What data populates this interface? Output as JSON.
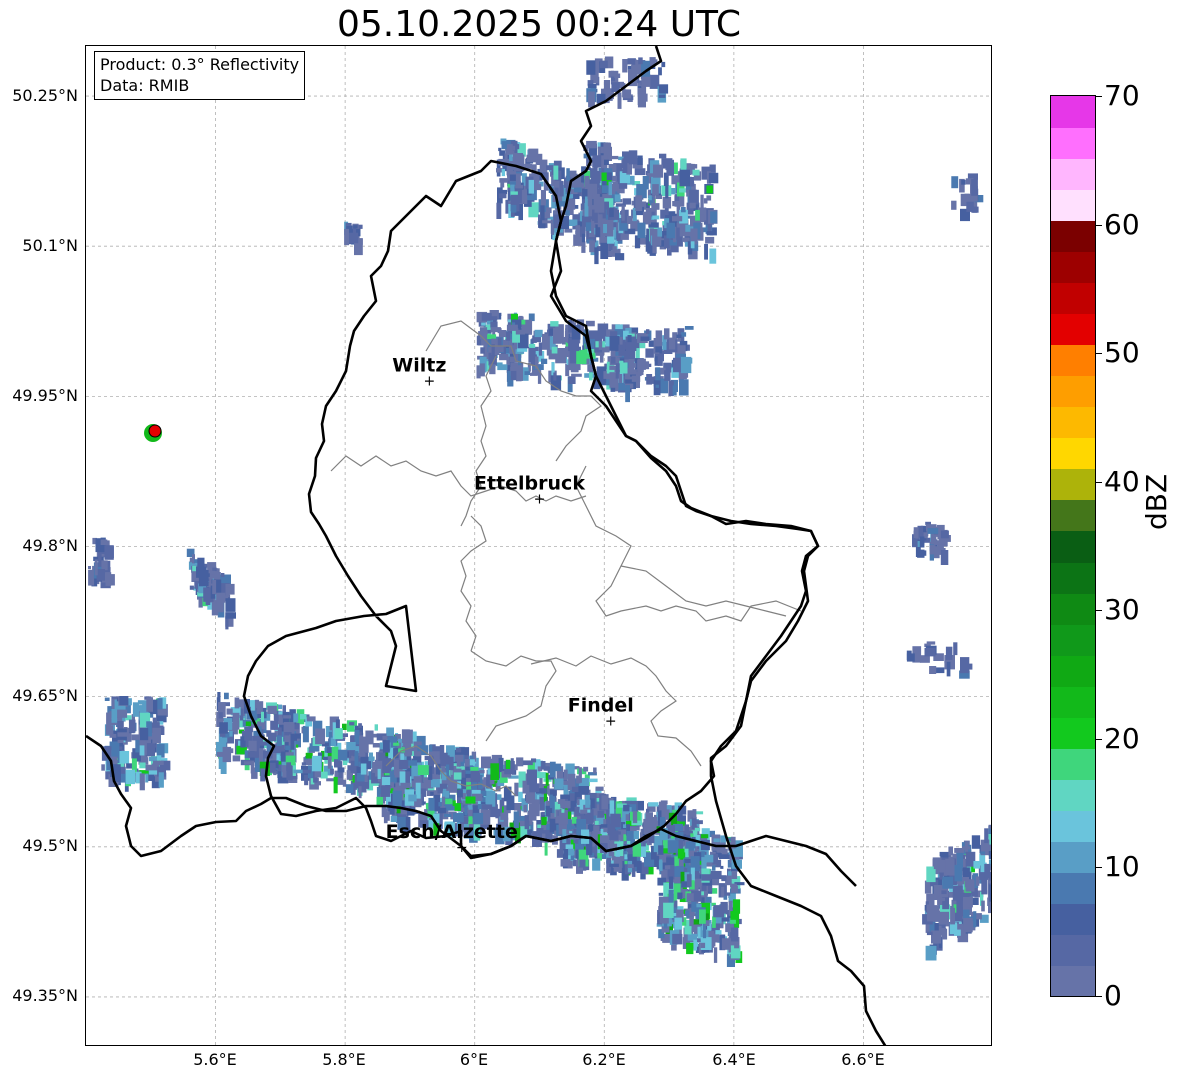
{
  "title": "05.10.2025 00:24 UTC",
  "info": {
    "product": "Product: 0.3° Reflectivity",
    "source": "Data: RMIB"
  },
  "map": {
    "lon_range": [
      5.4,
      6.8
    ],
    "lat_range": [
      49.3,
      50.3
    ],
    "grid": true,
    "lat_ticks": [
      "50.25°N",
      "50.1°N",
      "49.95°N",
      "49.8°N",
      "49.65°N",
      "49.5°N",
      "49.35°N"
    ],
    "lon_ticks": [
      "5.6°E",
      "5.8°E",
      "6°E",
      "6.2°E",
      "6.4°E",
      "6.6°E"
    ],
    "cities": [
      {
        "name": "Wiltz",
        "lon": 5.93,
        "lat": 49.966
      },
      {
        "name": "Ettelbruck",
        "lon": 6.1,
        "lat": 49.848
      },
      {
        "name": "Findel",
        "lon": 6.21,
        "lat": 49.626
      },
      {
        "name": "Esch/Alzette",
        "lon": 5.98,
        "lat": 49.5
      }
    ],
    "radar_site_marker": "red-dot",
    "border_color": "#000000",
    "canton_border_color": "#808080"
  },
  "colorbar": {
    "label": "dBZ",
    "min": 0,
    "max": 70,
    "ticks": [
      "0",
      "10",
      "20",
      "30",
      "40",
      "50",
      "60",
      "70"
    ],
    "colors": [
      "#6673a8",
      "#5668a4",
      "#4660a0",
      "#4a79b0",
      "#599ec6",
      "#6ac4dc",
      "#60d6c2",
      "#3fd67c",
      "#12c91e",
      "#12b91a",
      "#10a914",
      "#10991a",
      "#0f8a14",
      "#0c7415",
      "#0a5e14",
      "#44761a",
      "#adb30a",
      "#ffd700",
      "#fdb900",
      "#fe9e00",
      "#ff7f00",
      "#e30000",
      "#c10000",
      "#9d0000",
      "#7b0000",
      "#ffe0fe",
      "#ffb6fe",
      "#ff6ffe",
      "#e637e8"
    ]
  }
}
